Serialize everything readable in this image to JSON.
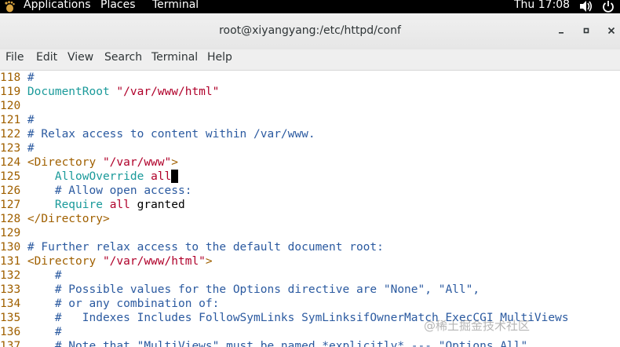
{
  "topbar": {
    "applications": "Applications",
    "places": "Places",
    "terminal": "Terminal",
    "clock": "Thu 17:08"
  },
  "window": {
    "title": "root@xiyangyang:/etc/httpd/conf"
  },
  "menubar": [
    "File",
    "Edit",
    "View",
    "Search",
    "Terminal",
    "Help"
  ],
  "lines": [
    {
      "n": "118",
      "segs": [
        {
          "c": "cm",
          "t": "#"
        }
      ]
    },
    {
      "n": "119",
      "segs": [
        {
          "c": "kw",
          "t": "DocumentRoot"
        },
        {
          "c": "tx",
          "t": " "
        },
        {
          "c": "st",
          "t": "\"/var/www/html\""
        }
      ]
    },
    {
      "n": "120",
      "segs": []
    },
    {
      "n": "121",
      "segs": [
        {
          "c": "cm",
          "t": "#"
        }
      ]
    },
    {
      "n": "122",
      "segs": [
        {
          "c": "cm",
          "t": "# Relax access to content within /var/www."
        }
      ]
    },
    {
      "n": "123",
      "segs": [
        {
          "c": "cm",
          "t": "#"
        }
      ]
    },
    {
      "n": "124",
      "segs": [
        {
          "c": "tg",
          "t": "<Directory "
        },
        {
          "c": "st",
          "t": "\"/var/www\""
        },
        {
          "c": "tg",
          "t": ">"
        }
      ]
    },
    {
      "n": "125",
      "segs": [
        {
          "c": "tx",
          "t": "    "
        },
        {
          "c": "kw",
          "t": "AllowOverride"
        },
        {
          "c": "tx",
          "t": " "
        },
        {
          "c": "st",
          "t": "all"
        }
      ],
      "cursor": true
    },
    {
      "n": "126",
      "segs": [
        {
          "c": "tx",
          "t": "    "
        },
        {
          "c": "cm",
          "t": "# Allow open access:"
        }
      ]
    },
    {
      "n": "127",
      "segs": [
        {
          "c": "tx",
          "t": "    "
        },
        {
          "c": "kw",
          "t": "Require"
        },
        {
          "c": "tx",
          "t": " "
        },
        {
          "c": "st",
          "t": "all"
        },
        {
          "c": "tx",
          "t": " granted"
        }
      ]
    },
    {
      "n": "128",
      "segs": [
        {
          "c": "tg",
          "t": "</Directory>"
        }
      ]
    },
    {
      "n": "129",
      "segs": []
    },
    {
      "n": "130",
      "segs": [
        {
          "c": "cm",
          "t": "# Further relax access to the default document root:"
        }
      ]
    },
    {
      "n": "131",
      "segs": [
        {
          "c": "tg",
          "t": "<Directory "
        },
        {
          "c": "st",
          "t": "\"/var/www/html\""
        },
        {
          "c": "tg",
          "t": ">"
        }
      ]
    },
    {
      "n": "132",
      "segs": [
        {
          "c": "tx",
          "t": "    "
        },
        {
          "c": "cm",
          "t": "#"
        }
      ]
    },
    {
      "n": "133",
      "segs": [
        {
          "c": "tx",
          "t": "    "
        },
        {
          "c": "cm",
          "t": "# Possible values for the Options directive are \"None\", \"All\","
        }
      ]
    },
    {
      "n": "134",
      "segs": [
        {
          "c": "tx",
          "t": "    "
        },
        {
          "c": "cm",
          "t": "# or any combination of:"
        }
      ]
    },
    {
      "n": "135",
      "segs": [
        {
          "c": "tx",
          "t": "    "
        },
        {
          "c": "cm",
          "t": "#   Indexes Includes FollowSymLinks SymLinksifOwnerMatch ExecCGI MultiViews"
        }
      ]
    },
    {
      "n": "136",
      "segs": [
        {
          "c": "tx",
          "t": "    "
        },
        {
          "c": "cm",
          "t": "#"
        }
      ]
    },
    {
      "n": "137",
      "segs": [
        {
          "c": "tx",
          "t": "    "
        },
        {
          "c": "cm",
          "t": "# Note that \"MultiViews\" must be named *explicitly* --- \"Options All\""
        }
      ]
    }
  ],
  "watermark": "@稀土掘金技术社区",
  "icons": {
    "apps": "gnome-foot-icon",
    "volume": "volume-icon",
    "power": "power-icon",
    "minimize": "minimize-icon",
    "maximize": "maximize-icon",
    "close": "close-icon"
  }
}
